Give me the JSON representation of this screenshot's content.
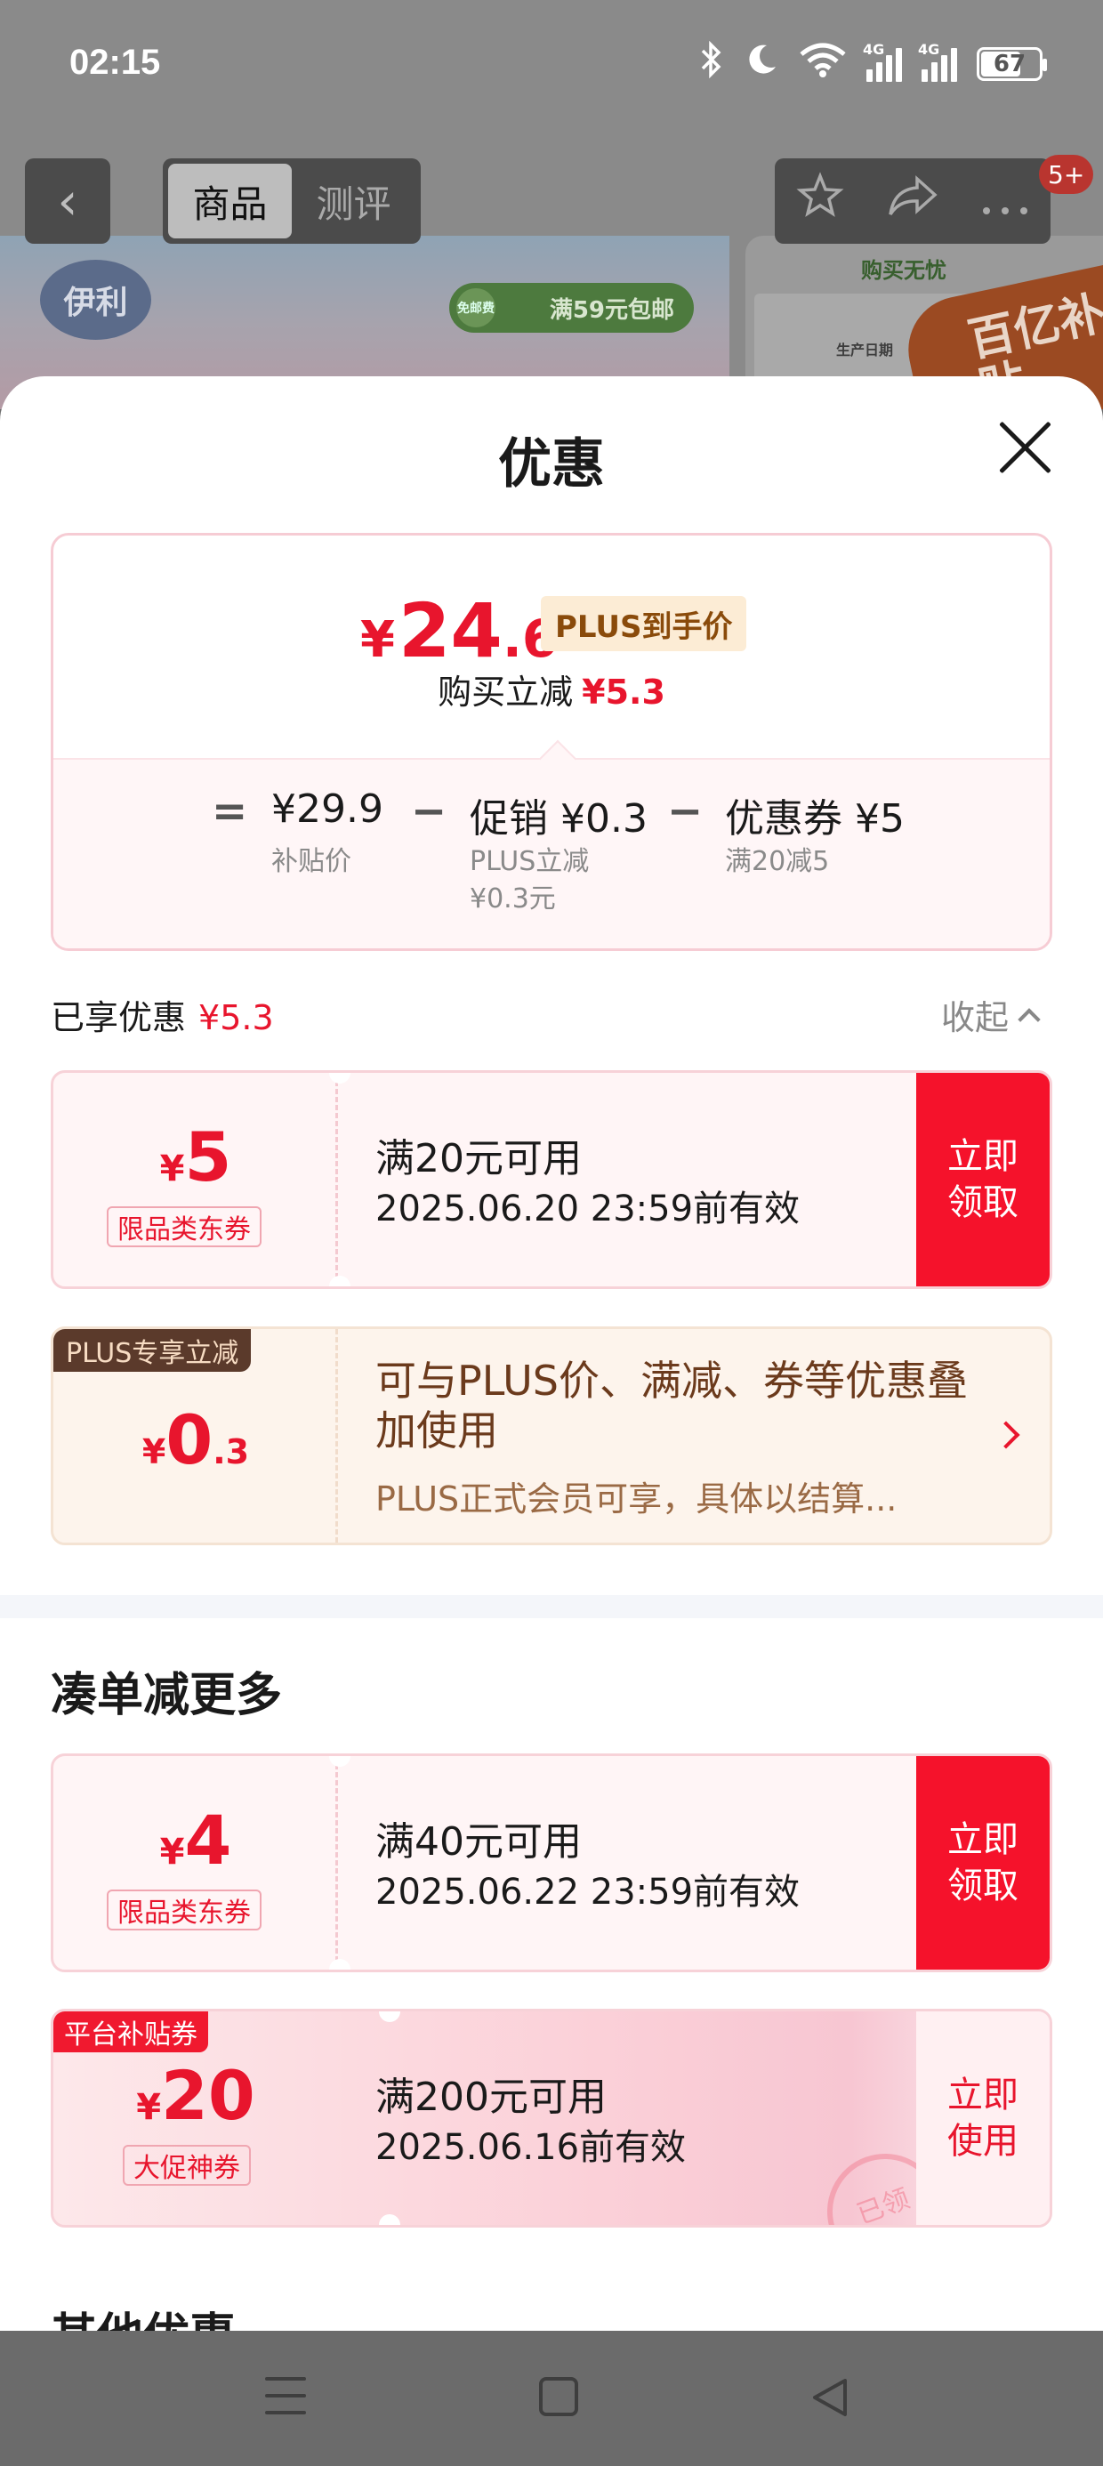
{
  "status_bar": {
    "time": "02:15",
    "battery": "67",
    "network1": "4G",
    "network2": "4G"
  },
  "background": {
    "tabs": [
      "商品",
      "测评"
    ],
    "badge": "5+",
    "logo": "伊利",
    "banner_pill": "满59元包邮",
    "banner_pill_icon_text": "免邮费",
    "right_card_title": "购买无忧",
    "right_card_text": "生产日期",
    "subsidy_text": "百亿补贴"
  },
  "sheet": {
    "title": "优惠",
    "price": {
      "currency": "¥",
      "integer": "24",
      "decimal": ".6",
      "plus_tag": "PLUS到手价",
      "instant_cut_label": "购买立减",
      "instant_cut_value": "¥5.3"
    },
    "calc": {
      "equals": "=",
      "minus": "−",
      "base_value": "¥29.9",
      "base_label": "补贴价",
      "promo_value": "促销 ¥0.3",
      "promo_label_1": "PLUS立减",
      "promo_label_2": "¥0.3元",
      "coupon_value": "优惠券 ¥5",
      "coupon_label": "满20减5"
    },
    "enjoyed_label": "已享优惠",
    "enjoyed_value": "¥5.3",
    "collapse_label": "收起",
    "coupons": [
      {
        "yen": "¥",
        "amount": "5",
        "type": "限品类东券",
        "condition": "满20元可用",
        "expiry": "2025.06.20 23:59前有效",
        "action": "立即\n领取"
      },
      {
        "yen": "¥",
        "amount": "4",
        "type": "限品类东券",
        "condition": "满40元可用",
        "expiry": "2025.06.22 23:59前有效",
        "action": "立即\n领取"
      },
      {
        "label": "平台补贴券",
        "yen": "¥",
        "amount": "20",
        "type": "大促神券",
        "condition": "满200元可用",
        "expiry": "2025.06.16前有效",
        "action": "立即\n使用",
        "stamp": "已领"
      }
    ],
    "plus_coupon": {
      "label": "PLUS专享立减",
      "yen": "¥",
      "amount": "0",
      "decimal": ".3",
      "text": "可与PLUS价、满减、券等优惠叠加使用",
      "desc": "PLUS正式会员可享，具体以结算..."
    },
    "section_more": "凑单减更多",
    "section_other": "其他优惠"
  },
  "colors": {
    "accent": "#e8152d",
    "plus_brown": "#5b3a2b",
    "action_red": "#f5122b"
  }
}
